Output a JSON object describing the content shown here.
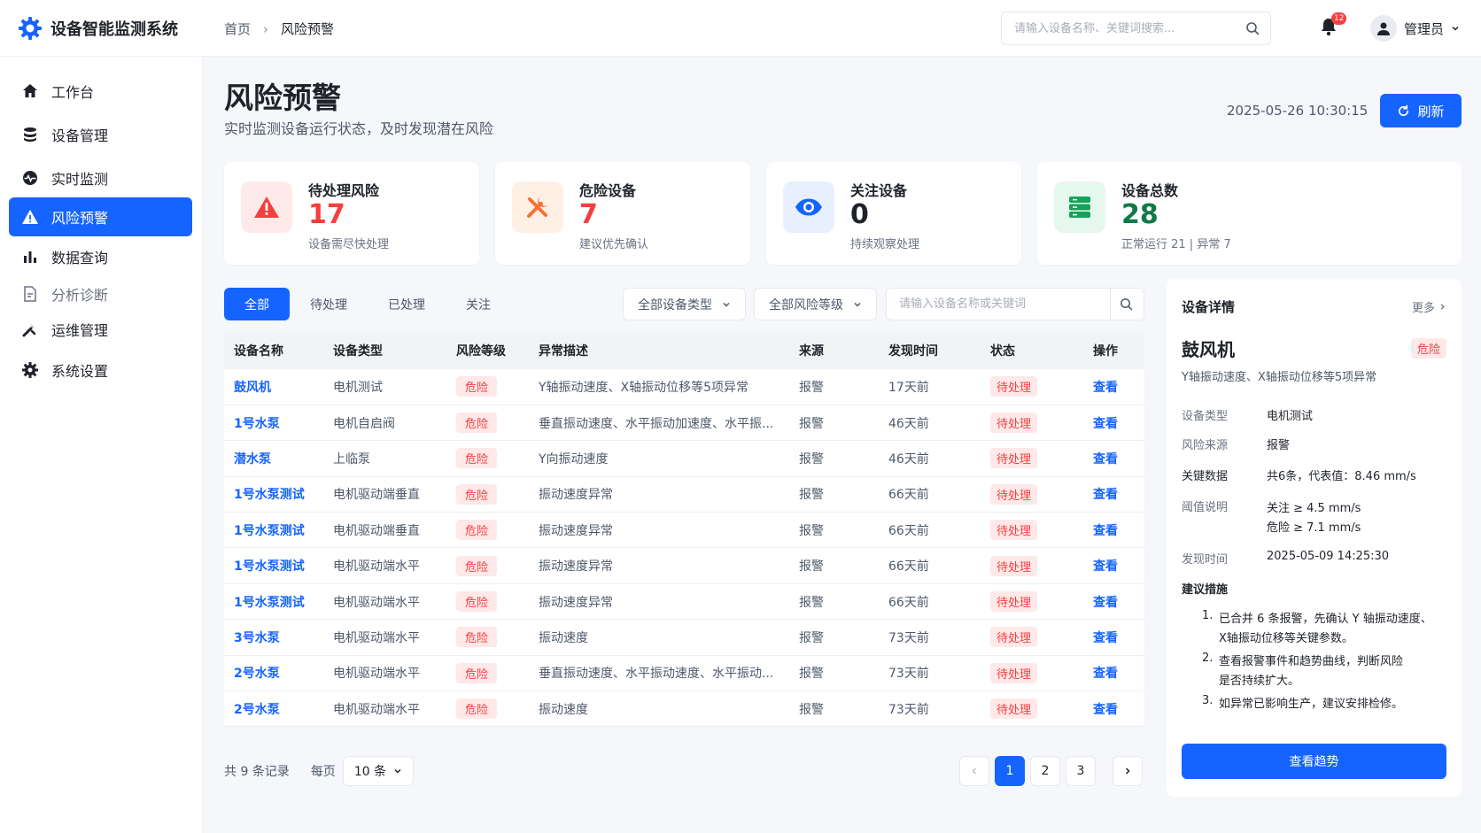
{
  "app": {
    "title": "设备智能监测系统"
  },
  "breadcrumb": {
    "home": "首页",
    "current": "风险预警"
  },
  "topbar": {
    "search_placeholder": "请输入设备名称、关键词搜索...",
    "notification_count": "12",
    "user_name": "管理员"
  },
  "sidebar": {
    "items": [
      {
        "label": "工作台",
        "icon": "home-icon"
      },
      {
        "label": "设备管理",
        "icon": "database-icon"
      },
      {
        "label": "实时监测",
        "icon": "monitor-icon"
      },
      {
        "label": "风险预警",
        "icon": "warning-icon",
        "active": true
      },
      {
        "label": "数据查询",
        "icon": "bar-chart-icon"
      },
      {
        "label": "分析诊断",
        "icon": "document-icon"
      },
      {
        "label": "运维管理",
        "icon": "tools-icon"
      },
      {
        "label": "系统设置",
        "icon": "gear-icon"
      }
    ]
  },
  "header": {
    "title": "风险预警",
    "subtitle": "实时监测设备运行状态，及时发现潜在风险",
    "datetime": "2025-05-26 10:30:15",
    "refresh_label": "刷新"
  },
  "stats": [
    {
      "title": "待处理风险",
      "value": "17",
      "desc": "设备需尽快处理",
      "color": "#f53f3f",
      "icon": "alert-triangle-icon"
    },
    {
      "title": "危险设备",
      "value": "7",
      "desc": "建议优先确认",
      "color": "#f53f3f",
      "icon": "tools-icon"
    },
    {
      "title": "关注设备",
      "value": "0",
      "desc": "持续观察处理",
      "color": "#1f2329",
      "icon": "eye-icon"
    },
    {
      "title": "设备总数",
      "value": "28",
      "desc": "正常运行 21 | 异常 7",
      "color": "#0e7a46",
      "icon": "server-icon"
    }
  ],
  "filters": {
    "tabs": [
      "全部",
      "待处理",
      "已处理",
      "关注"
    ],
    "device_type": "全部设备类型",
    "risk_level": "全部风险等级",
    "search_placeholder": "请输入设备名称或关键词"
  },
  "table": {
    "columns": [
      "设备名称",
      "设备类型",
      "风险等级",
      "异常描述",
      "来源",
      "发现时间",
      "状态",
      "操作"
    ],
    "rows": [
      [
        "鼓风机",
        "电机测试",
        "危险",
        "Y轴振动速度、X轴振动位移等5项异常",
        "报警",
        "17天前",
        "待处理",
        "查看"
      ],
      [
        "1号水泵",
        "电机自启阀",
        "危险",
        "垂直振动速度、水平振动加速度、水平振...",
        "报警",
        "46天前",
        "待处理",
        "查看"
      ],
      [
        "潜水泵",
        "上临泵",
        "危险",
        "Y向振动速度",
        "报警",
        "46天前",
        "待处理",
        "查看"
      ],
      [
        "1号水泵测试",
        "电机驱动端垂直",
        "危险",
        "振动速度异常",
        "报警",
        "66天前",
        "待处理",
        "查看"
      ],
      [
        "1号水泵测试",
        "电机驱动端垂直",
        "危险",
        "振动速度异常",
        "报警",
        "66天前",
        "待处理",
        "查看"
      ],
      [
        "1号水泵测试",
        "电机驱动端水平",
        "危险",
        "振动速度异常",
        "报警",
        "66天前",
        "待处理",
        "查看"
      ],
      [
        "1号水泵测试",
        "电机驱动端水平",
        "危险",
        "振动速度异常",
        "报警",
        "66天前",
        "待处理",
        "查看"
      ],
      [
        "3号水泵",
        "电机驱动端水平",
        "危险",
        "振动速度",
        "报警",
        "73天前",
        "待处理",
        "查看"
      ],
      [
        "2号水泵",
        "电机驱动端水平",
        "危险",
        "垂直振动速度、水平振动速度、水平振动...",
        "报警",
        "73天前",
        "待处理",
        "查看"
      ],
      [
        "2号水泵",
        "电机驱动端水平",
        "危险",
        "振动速度",
        "报警",
        "73天前",
        "待处理",
        "查看"
      ]
    ]
  },
  "pagination": {
    "total": "共 9 条记录",
    "per_page_label": "每页",
    "page_size": "10 条",
    "pages": [
      "1",
      "2",
      "3"
    ]
  },
  "detail": {
    "title": "设备详情",
    "more": "更多",
    "device_name": "鼓风机",
    "level": "危险",
    "summary": "Y轴振动速度、X轴振动位移等5项异常",
    "fields": [
      {
        "label": "设备类型",
        "value": "电机测试"
      },
      {
        "label": "风险来源",
        "value": "报警"
      },
      {
        "label": "关键数据",
        "value": "共6条，代表值：8.46 mm/s"
      },
      {
        "label": "阈值说明",
        "value": "关注 ≥ 4.5 mm/s",
        "value2": "危险 ≥ 7.1 mm/s"
      },
      {
        "label": "发现时间",
        "value": "2025-05-09 14:25:30"
      }
    ],
    "advice_title": "建议措施",
    "advice": [
      {
        "num": "1.",
        "line1": "已合并 6 条报警，先确认 Y 轴振动速度、",
        "line2": "X轴振动位移等关键参数。"
      },
      {
        "num": "2.",
        "line1": "查看报警事件和趋势曲线，判断风险",
        "line2": "是否持续扩大。"
      },
      {
        "num": "3.",
        "line1": "如异常已影响生产，建议安排检修。",
        "line2": ""
      }
    ],
    "button": "查看趋势"
  }
}
